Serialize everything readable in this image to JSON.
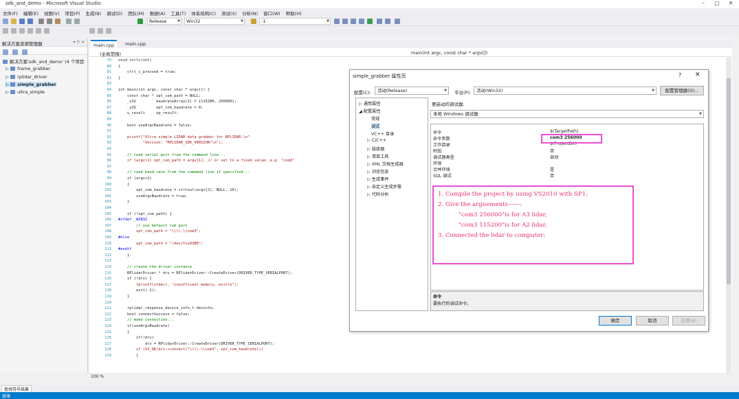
{
  "window": {
    "title": "sdk_and_demo - Microsoft Visual Studio"
  },
  "menu": [
    "文件(F)",
    "编辑(E)",
    "视图(V)",
    "项目(P)",
    "生成(B)",
    "调试(D)",
    "团队(M)",
    "数据(A)",
    "工具(T)",
    "体系结构(C)",
    "测试(S)",
    "分析(N)",
    "窗口(W)",
    "帮助(H)"
  ],
  "toolbar": {
    "config": "Release",
    "platform": "Win32",
    "find_value": "-1"
  },
  "solution_explorer": {
    "title": "解决方案资源管理器",
    "pin": "▾ ⊓ ✕",
    "items": [
      {
        "label": "解决方案'sdk_and_demo' (4 个项目"
      },
      {
        "label": "frame_grabber"
      },
      {
        "label": "rplidar_driver"
      },
      {
        "label": "simple_grabber"
      },
      {
        "label": "ultra_simple"
      }
    ]
  },
  "editor": {
    "tabs": [
      "main.cpp",
      "main.cpp"
    ],
    "scope_left": "(全局范围)",
    "scope_right": "main(int argc, const char * argv[])",
    "zoom": "100 %",
    "lines": [
      {
        "n": "79",
        "t": "void ctrlc(int)"
      },
      {
        "n": "80",
        "t": "{"
      },
      {
        "n": "81",
        "t": "    ctrl_c_pressed = true;"
      },
      {
        "n": "82",
        "t": "}"
      },
      {
        "n": "83",
        "t": ""
      },
      {
        "n": "84",
        "t": "int main(int argc, const char * argv[]) {"
      },
      {
        "n": "85",
        "t": "    const char * opt_com_path = NULL;"
      },
      {
        "n": "86",
        "t": "    _u32         baudrateArray[2] = {115200, 256000};"
      },
      {
        "n": "87",
        "t": "    _u32         opt_com_baudrate = 0;"
      },
      {
        "n": "88",
        "t": "    u_result     op_result;"
      },
      {
        "n": "89",
        "t": ""
      },
      {
        "n": "90",
        "t": "    bool useArgcBaudrate = false;"
      },
      {
        "n": "91",
        "t": ""
      },
      {
        "n": "92",
        "t": "    printf(\"Ultra simple LIDAR data grabber for RPLIDAR.\\n\""
      },
      {
        "n": "93",
        "t": "           \"Version: \"RPLIDAR_SDK_VERSION\"\\n\");"
      },
      {
        "n": "94",
        "t": ""
      },
      {
        "n": "95",
        "t": "    // read serial port from the command line..."
      },
      {
        "n": "96",
        "t": "    if (argc>1) opt_com_path = argv[1]; // or set to a fixed value: e.g. \"com3\""
      },
      {
        "n": "97",
        "t": ""
      },
      {
        "n": "98",
        "t": "    // read baud rate from the command line if specified..."
      },
      {
        "n": "99",
        "t": "    if (argc>2)"
      },
      {
        "n": "100",
        "t": "    {"
      },
      {
        "n": "101",
        "t": "        opt_com_baudrate = strtoul(argv[2], NULL, 10);"
      },
      {
        "n": "102",
        "t": "        useArgcBaudrate = true;"
      },
      {
        "n": "103",
        "t": "    }"
      },
      {
        "n": "104",
        "t": ""
      },
      {
        "n": "105",
        "t": "    if (!opt_com_path) {"
      },
      {
        "n": "106",
        "t": "#ifdef _WIN32"
      },
      {
        "n": "107",
        "t": "        // use default com port"
      },
      {
        "n": "108",
        "t": "        opt_com_path = \"\\\\\\\\.\\\\com3\";"
      },
      {
        "n": "109",
        "t": "#else"
      },
      {
        "n": "110",
        "t": "        opt_com_path = \"/dev/ttyUSB0\";"
      },
      {
        "n": "111",
        "t": "#endif"
      },
      {
        "n": "112",
        "t": "    }"
      },
      {
        "n": "113",
        "t": ""
      },
      {
        "n": "114",
        "t": "    // create the driver instance"
      },
      {
        "n": "115",
        "t": "    RPlidarDriver * drv = RPlidarDriver::CreateDriver(DRIVER_TYPE_SERIALPORT);"
      },
      {
        "n": "116",
        "t": "    if (!drv) {"
      },
      {
        "n": "117",
        "t": "        fprintf(stderr, \"insufficent memory, exit\\n\");"
      },
      {
        "n": "118",
        "t": "        exit(-2);"
      },
      {
        "n": "119",
        "t": "    }"
      },
      {
        "n": "120",
        "t": ""
      },
      {
        "n": "121",
        "t": "    rplidar_response_device_info_t devinfo;"
      },
      {
        "n": "122",
        "t": "    bool connectSuccess = false;"
      },
      {
        "n": "123",
        "t": "    // make connection..."
      },
      {
        "n": "124",
        "t": "    if(useArgcBaudrate)"
      },
      {
        "n": "125",
        "t": "    {"
      },
      {
        "n": "126",
        "t": "        if(!drv)"
      },
      {
        "n": "127",
        "t": "            drv = RPlidarDriver::CreateDriver(DRIVER_TYPE_SERIALPORT);"
      },
      {
        "n": "128",
        "t": "        if (IS_OK(drv->connect(\"\\\\\\\\.\\\\com3\", opt_com_baudrate)))"
      },
      {
        "n": "129",
        "t": "        {"
      }
    ]
  },
  "dialog": {
    "title": "simple_grabber 属性页",
    "help": "?",
    "close": "✕",
    "config_label": "配置(C):",
    "config_value": "活动(Release)",
    "platform_label": "平台(P):",
    "platform_value": "活动(Win32)",
    "config_manager": "配置管理器(O)...",
    "debugger_label": "要启动的调试器:",
    "debugger_value": "本地 Windows 调试器",
    "tree": [
      "通用属性",
      "配置属性",
      "常规",
      "调试",
      "VC++ 目录",
      "C/C++",
      "链接器",
      "清单工具",
      "XML 文档生成器",
      "浏览信息",
      "生成事件",
      "自定义生成步骤",
      "代码分析"
    ],
    "props": [
      {
        "name": "命令",
        "value": "$(TargetPath)"
      },
      {
        "name": "命令参数",
        "value": "com3 256000"
      },
      {
        "name": "工作目录",
        "value": "$(ProjectDir)"
      },
      {
        "name": "附加",
        "value": "否"
      },
      {
        "name": "调试器类型",
        "value": "自动"
      },
      {
        "name": "环境",
        "value": ""
      },
      {
        "name": "合并环境",
        "value": "是"
      },
      {
        "name": "SQL 调试",
        "value": "否"
      }
    ],
    "desc_title": "命令",
    "desc_text": "要执行的调试命令。",
    "ok": "确定",
    "cancel": "取消",
    "apply": "应用(A)"
  },
  "annotation": {
    "lines": [
      "1. Compile the project by using VS2010 with SP1;",
      "2. Give the arguements——:",
      "\"com3 256000\"is for A3 lidar,",
      "\"com3 115200\"is for A2 lidar,",
      "3. Connected the lidar to computer;"
    ],
    "color": "#e8336f"
  },
  "find_results": "查找符号结果",
  "status": "就绪"
}
